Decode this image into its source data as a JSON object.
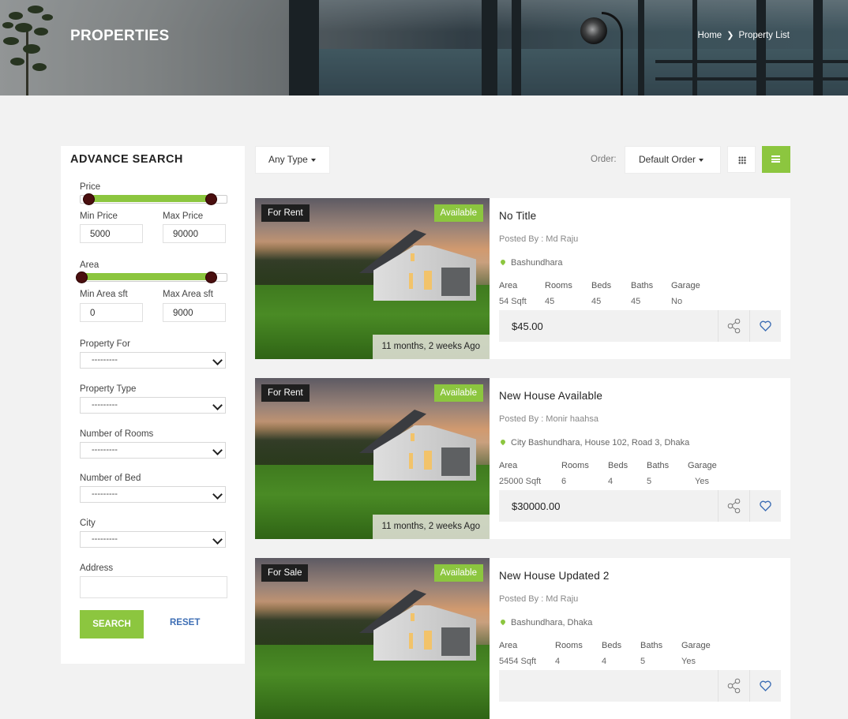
{
  "hero": {
    "title": "PROPERTIES",
    "breadcrumb": [
      "Home",
      "Property List"
    ]
  },
  "sidebar": {
    "heading": "ADVANCE SEARCH",
    "price_label": "Price",
    "min_price_label": "Min Price",
    "min_price": "5000",
    "max_price_label": "Max Price",
    "max_price": "90000",
    "area_label": "Area",
    "min_area_label": "Min Area sft",
    "min_area": "0",
    "max_area_label": "Max Area sft",
    "max_area": "9000",
    "selects": [
      {
        "label": "Property For",
        "value": "---------"
      },
      {
        "label": "Property Type",
        "value": "---------"
      },
      {
        "label": "Number of Rooms",
        "value": "---------"
      },
      {
        "label": "Number of Bed",
        "value": "---------"
      },
      {
        "label": "City",
        "value": "---------"
      }
    ],
    "address_label": "Address",
    "address_value": "",
    "search_label": "SEARCH",
    "reset_label": "RESET"
  },
  "toolbar": {
    "type_filter": "Any Type",
    "order_label": "Order:",
    "order_value": "Default Order"
  },
  "colors": {
    "accent": "#8cc63f",
    "dark_badge": "#1f1f1f",
    "link": "#3f6fb5"
  },
  "listings": [
    {
      "type_badge": "For Rent",
      "status_badge": "Available",
      "ago": "11 months, 2 weeks Ago",
      "title": "No Title",
      "posted": "Posted By : Md Raju",
      "location": "Bashundhara",
      "facts": [
        {
          "k": "Area",
          "v": "54 Sqft"
        },
        {
          "k": "Rooms",
          "v": "45"
        },
        {
          "k": "Beds",
          "v": "45"
        },
        {
          "k": "Baths",
          "v": "45"
        },
        {
          "k": "Garage",
          "v": "No"
        }
      ],
      "price": "$45.00"
    },
    {
      "type_badge": "For Rent",
      "status_badge": "Available",
      "ago": "11 months, 2 weeks Ago",
      "title": "New House Available",
      "posted": "Posted By : Monir haahsa",
      "location": "City Bashundhara, House 102, Road 3, Dhaka",
      "facts": [
        {
          "k": "Area",
          "v": "25000 Sqft"
        },
        {
          "k": "Rooms",
          "v": "6"
        },
        {
          "k": "Beds",
          "v": "4"
        },
        {
          "k": "Baths",
          "v": "5"
        },
        {
          "k": "Garage",
          "v": "Yes"
        }
      ],
      "price": "$30000.00"
    },
    {
      "type_badge": "For Sale",
      "status_badge": "Available",
      "ago": "",
      "title": "New House Updated 2",
      "posted": "Posted By : Md Raju",
      "location": "Bashundhara, Dhaka",
      "facts": [
        {
          "k": "Area",
          "v": "5454 Sqft"
        },
        {
          "k": "Rooms",
          "v": "4"
        },
        {
          "k": "Beds",
          "v": "4"
        },
        {
          "k": "Baths",
          "v": "5"
        },
        {
          "k": "Garage",
          "v": "Yes"
        }
      ],
      "price": ""
    }
  ]
}
